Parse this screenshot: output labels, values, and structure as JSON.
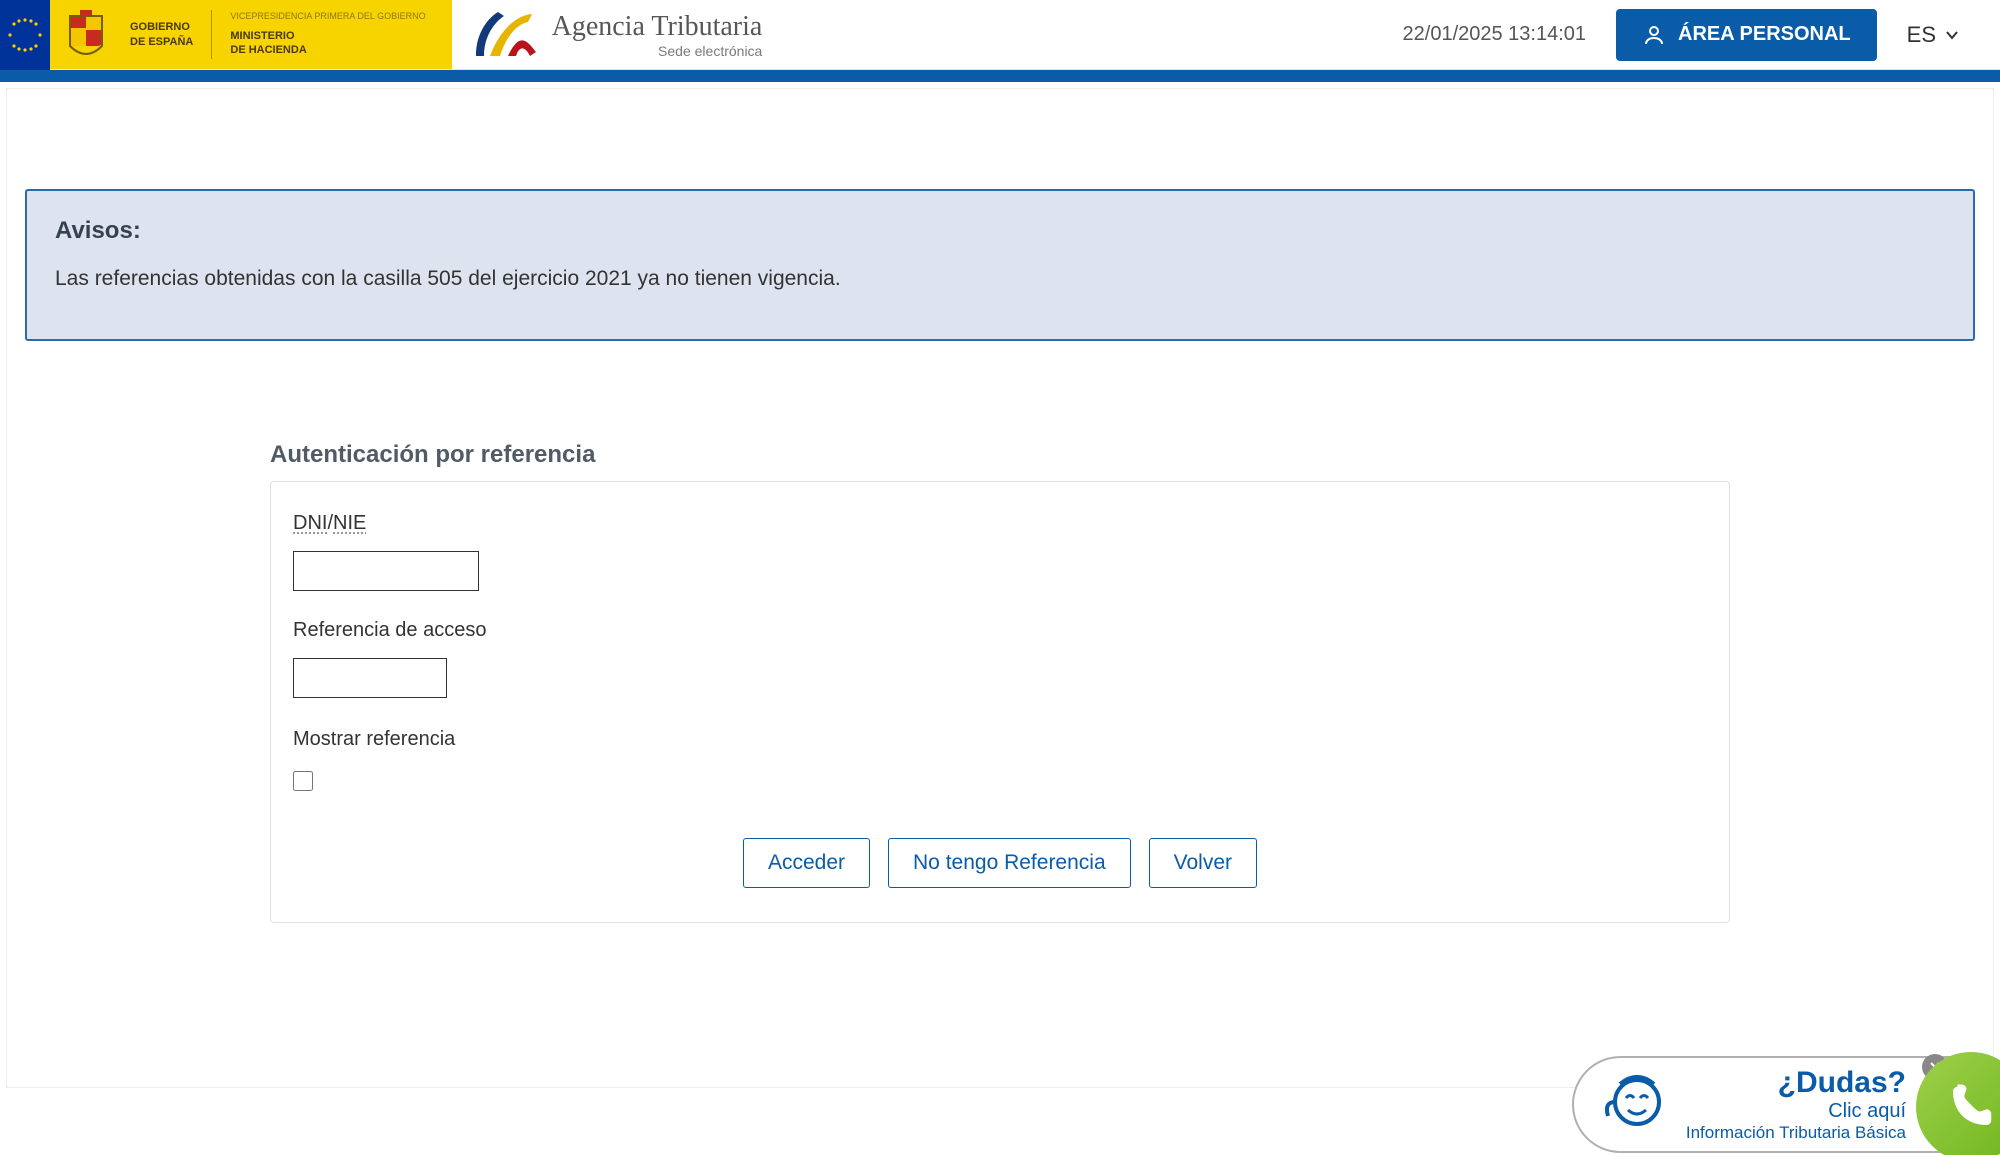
{
  "header": {
    "gov_label_top": "GOBIERNO",
    "gov_label_bottom": "DE ESPAÑA",
    "vice_label": "VICEPRESIDENCIA PRIMERA DEL GOBIERNO",
    "ministry_label_top": "MINISTERIO",
    "ministry_label_bottom": "DE HACIENDA",
    "agency_title": "Agencia Tributaria",
    "agency_subtitle": "Sede electrónica",
    "timestamp": "22/01/2025 13:14:01",
    "area_personal_label": "ÁREA PERSONAL",
    "language": "ES"
  },
  "notice": {
    "title": "Avisos:",
    "body": "Las referencias obtenidas con la casilla 505 del ejercicio 2021 ya no tienen vigencia."
  },
  "auth": {
    "heading": "Autenticación por referencia",
    "dni_label_1": "DNI",
    "dni_label_sep": "/",
    "dni_label_2": "NIE",
    "ref_label": "Referencia de acceso",
    "show_ref_label": "Mostrar referencia",
    "dni_value": "",
    "ref_value": ""
  },
  "buttons": {
    "acceder": "Acceder",
    "no_ref": "No tengo Referencia",
    "volver": "Volver"
  },
  "help": {
    "question": "¿Dudas?",
    "click": "Clic aquí",
    "subtitle": "Información Tributaria Básica"
  }
}
